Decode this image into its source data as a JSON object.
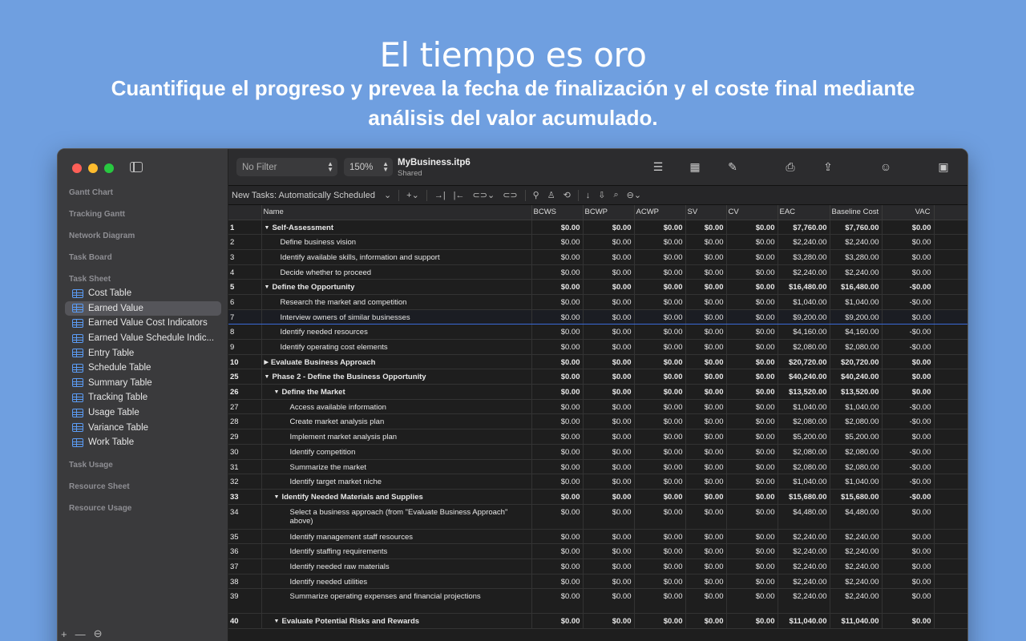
{
  "hero": {
    "title": "El tiempo es oro",
    "subtitle": "Cuantifique el progreso y prevea la fecha de finalización y el coste final mediante análisis del valor acumulado."
  },
  "sidebar": {
    "sections": {
      "gantt": "Gantt Chart",
      "tracking_gantt": "Tracking Gantt",
      "network": "Network Diagram",
      "board": "Task Board",
      "sheet": "Task Sheet",
      "usage": "Task Usage",
      "resource_sheet": "Resource Sheet",
      "resource_usage": "Resource Usage"
    },
    "items": [
      {
        "label": "Cost Table"
      },
      {
        "label": "Earned Value"
      },
      {
        "label": "Earned Value Cost Indicators"
      },
      {
        "label": "Earned Value Schedule Indic..."
      },
      {
        "label": "Entry Table"
      },
      {
        "label": "Schedule Table"
      },
      {
        "label": "Summary Table"
      },
      {
        "label": "Tracking Table"
      },
      {
        "label": "Usage Table"
      },
      {
        "label": "Variance Table"
      },
      {
        "label": "Work Table"
      }
    ],
    "footer": {
      "add": "+",
      "remove": "—",
      "more": "⊖"
    }
  },
  "toolbar": {
    "filter": "No Filter",
    "zoom": "150%",
    "doc_title": "MyBusiness.itp6",
    "doc_sub": "Shared",
    "new_tasks": "New Tasks: Automatically Scheduled"
  },
  "table": {
    "columns": [
      "",
      "Name",
      "BCWS",
      "BCWP",
      "ACWP",
      "SV",
      "CV",
      "EAC",
      "Baseline Cost",
      "VAC"
    ],
    "rows": [
      {
        "id": "1",
        "name": "Self-Assessment",
        "level": 0,
        "summary": true,
        "tri": "▼",
        "bcws": "$0.00",
        "bcwp": "$0.00",
        "acwp": "$0.00",
        "sv": "$0.00",
        "cv": "$0.00",
        "eac": "$7,760.00",
        "base": "$7,760.00",
        "vac": "$0.00"
      },
      {
        "id": "2",
        "name": "Define business vision",
        "level": 1,
        "bcws": "$0.00",
        "bcwp": "$0.00",
        "acwp": "$0.00",
        "sv": "$0.00",
        "cv": "$0.00",
        "eac": "$2,240.00",
        "base": "$2,240.00",
        "vac": "$0.00"
      },
      {
        "id": "3",
        "name": "Identify available skills, information and support",
        "level": 1,
        "bcws": "$0.00",
        "bcwp": "$0.00",
        "acwp": "$0.00",
        "sv": "$0.00",
        "cv": "$0.00",
        "eac": "$3,280.00",
        "base": "$3,280.00",
        "vac": "$0.00"
      },
      {
        "id": "4",
        "name": "Decide whether to proceed",
        "level": 1,
        "bcws": "$0.00",
        "bcwp": "$0.00",
        "acwp": "$0.00",
        "sv": "$0.00",
        "cv": "$0.00",
        "eac": "$2,240.00",
        "base": "$2,240.00",
        "vac": "$0.00"
      },
      {
        "id": "5",
        "name": "Define the Opportunity",
        "level": 0,
        "summary": true,
        "tri": "▼",
        "bcws": "$0.00",
        "bcwp": "$0.00",
        "acwp": "$0.00",
        "sv": "$0.00",
        "cv": "$0.00",
        "eac": "$16,480.00",
        "base": "$16,480.00",
        "vac": "-$0.00"
      },
      {
        "id": "6",
        "name": "Research the market and competition",
        "level": 1,
        "bcws": "$0.00",
        "bcwp": "$0.00",
        "acwp": "$0.00",
        "sv": "$0.00",
        "cv": "$0.00",
        "eac": "$1,040.00",
        "base": "$1,040.00",
        "vac": "-$0.00"
      },
      {
        "id": "7",
        "name": "Interview owners of similar businesses",
        "level": 1,
        "selected": true,
        "bcws": "$0.00",
        "bcwp": "$0.00",
        "acwp": "$0.00",
        "sv": "$0.00",
        "cv": "$0.00",
        "eac": "$9,200.00",
        "base": "$9,200.00",
        "vac": "$0.00"
      },
      {
        "id": "8",
        "name": "Identify needed resources",
        "level": 1,
        "bcws": "$0.00",
        "bcwp": "$0.00",
        "acwp": "$0.00",
        "sv": "$0.00",
        "cv": "$0.00",
        "eac": "$4,160.00",
        "base": "$4,160.00",
        "vac": "-$0.00"
      },
      {
        "id": "9",
        "name": "Identify operating cost elements",
        "level": 1,
        "bcws": "$0.00",
        "bcwp": "$0.00",
        "acwp": "$0.00",
        "sv": "$0.00",
        "cv": "$0.00",
        "eac": "$2,080.00",
        "base": "$2,080.00",
        "vac": "-$0.00"
      },
      {
        "id": "10",
        "name": "Evaluate Business Approach",
        "level": 0,
        "summary": true,
        "tri": "▶",
        "bcws": "$0.00",
        "bcwp": "$0.00",
        "acwp": "$0.00",
        "sv": "$0.00",
        "cv": "$0.00",
        "eac": "$20,720.00",
        "base": "$20,720.00",
        "vac": "$0.00"
      },
      {
        "id": "25",
        "name": "Phase 2 - Define the Business Opportunity",
        "level": 0,
        "summary": true,
        "tri": "▼",
        "bcws": "$0.00",
        "bcwp": "$0.00",
        "acwp": "$0.00",
        "sv": "$0.00",
        "cv": "$0.00",
        "eac": "$40,240.00",
        "base": "$40,240.00",
        "vac": "$0.00"
      },
      {
        "id": "26",
        "name": "Define the Market",
        "level": 1,
        "summary": true,
        "tri": "▼",
        "bcws": "$0.00",
        "bcwp": "$0.00",
        "acwp": "$0.00",
        "sv": "$0.00",
        "cv": "$0.00",
        "eac": "$13,520.00",
        "base": "$13,520.00",
        "vac": "$0.00"
      },
      {
        "id": "27",
        "name": "Access available information",
        "level": 2,
        "bcws": "$0.00",
        "bcwp": "$0.00",
        "acwp": "$0.00",
        "sv": "$0.00",
        "cv": "$0.00",
        "eac": "$1,040.00",
        "base": "$1,040.00",
        "vac": "-$0.00"
      },
      {
        "id": "28",
        "name": "Create market analysis plan",
        "level": 2,
        "bcws": "$0.00",
        "bcwp": "$0.00",
        "acwp": "$0.00",
        "sv": "$0.00",
        "cv": "$0.00",
        "eac": "$2,080.00",
        "base": "$2,080.00",
        "vac": "-$0.00"
      },
      {
        "id": "29",
        "name": "Implement market analysis plan",
        "level": 2,
        "bcws": "$0.00",
        "bcwp": "$0.00",
        "acwp": "$0.00",
        "sv": "$0.00",
        "cv": "$0.00",
        "eac": "$5,200.00",
        "base": "$5,200.00",
        "vac": "$0.00"
      },
      {
        "id": "30",
        "name": "Identify competition",
        "level": 2,
        "bcws": "$0.00",
        "bcwp": "$0.00",
        "acwp": "$0.00",
        "sv": "$0.00",
        "cv": "$0.00",
        "eac": "$2,080.00",
        "base": "$2,080.00",
        "vac": "-$0.00"
      },
      {
        "id": "31",
        "name": "Summarize the market",
        "level": 2,
        "bcws": "$0.00",
        "bcwp": "$0.00",
        "acwp": "$0.00",
        "sv": "$0.00",
        "cv": "$0.00",
        "eac": "$2,080.00",
        "base": "$2,080.00",
        "vac": "-$0.00"
      },
      {
        "id": "32",
        "name": "Identify target market niche",
        "level": 2,
        "bcws": "$0.00",
        "bcwp": "$0.00",
        "acwp": "$0.00",
        "sv": "$0.00",
        "cv": "$0.00",
        "eac": "$1,040.00",
        "base": "$1,040.00",
        "vac": "-$0.00"
      },
      {
        "id": "33",
        "name": "Identify Needed Materials and Supplies",
        "level": 1,
        "summary": true,
        "tri": "▼",
        "bcws": "$0.00",
        "bcwp": "$0.00",
        "acwp": "$0.00",
        "sv": "$0.00",
        "cv": "$0.00",
        "eac": "$15,680.00",
        "base": "$15,680.00",
        "vac": "-$0.00"
      },
      {
        "id": "34",
        "name": "Select a business approach (from \"Evaluate Business Approach\" above)",
        "level": 2,
        "tall": true,
        "bcws": "$0.00",
        "bcwp": "$0.00",
        "acwp": "$0.00",
        "sv": "$0.00",
        "cv": "$0.00",
        "eac": "$4,480.00",
        "base": "$4,480.00",
        "vac": "$0.00"
      },
      {
        "id": "35",
        "name": "Identify management staff resources",
        "level": 2,
        "bcws": "$0.00",
        "bcwp": "$0.00",
        "acwp": "$0.00",
        "sv": "$0.00",
        "cv": "$0.00",
        "eac": "$2,240.00",
        "base": "$2,240.00",
        "vac": "$0.00"
      },
      {
        "id": "36",
        "name": "Identify staffing requirements",
        "level": 2,
        "bcws": "$0.00",
        "bcwp": "$0.00",
        "acwp": "$0.00",
        "sv": "$0.00",
        "cv": "$0.00",
        "eac": "$2,240.00",
        "base": "$2,240.00",
        "vac": "$0.00"
      },
      {
        "id": "37",
        "name": "Identify needed raw materials",
        "level": 2,
        "bcws": "$0.00",
        "bcwp": "$0.00",
        "acwp": "$0.00",
        "sv": "$0.00",
        "cv": "$0.00",
        "eac": "$2,240.00",
        "base": "$2,240.00",
        "vac": "$0.00"
      },
      {
        "id": "38",
        "name": "Identify needed utilities",
        "level": 2,
        "bcws": "$0.00",
        "bcwp": "$0.00",
        "acwp": "$0.00",
        "sv": "$0.00",
        "cv": "$0.00",
        "eac": "$2,240.00",
        "base": "$2,240.00",
        "vac": "$0.00"
      },
      {
        "id": "39",
        "name": "Summarize operating expenses and financial projections",
        "level": 2,
        "tall": true,
        "bcws": "$0.00",
        "bcwp": "$0.00",
        "acwp": "$0.00",
        "sv": "$0.00",
        "cv": "$0.00",
        "eac": "$2,240.00",
        "base": "$2,240.00",
        "vac": "$0.00"
      },
      {
        "id": "40",
        "name": "Evaluate Potential Risks and Rewards",
        "level": 1,
        "summary": true,
        "tri": "▼",
        "bcws": "$0.00",
        "bcwp": "$0.00",
        "acwp": "$0.00",
        "sv": "$0.00",
        "cv": "$0.00",
        "eac": "$11,040.00",
        "base": "$11,040.00",
        "vac": "$0.00"
      }
    ]
  }
}
